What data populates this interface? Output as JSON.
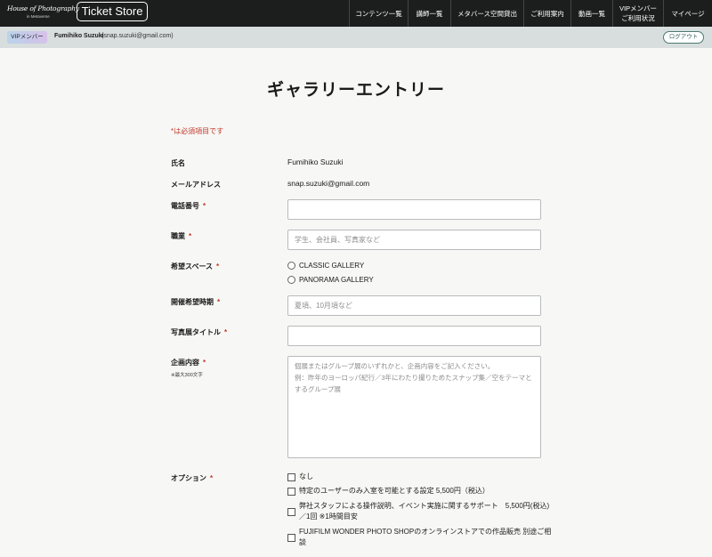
{
  "header": {
    "logo_main": "House of Photography",
    "logo_sub": "in Metaverse",
    "ticket_store": "Ticket Store",
    "nav": [
      {
        "label": "コンテンツ一覧"
      },
      {
        "label": "講師一覧"
      },
      {
        "label": "メタバース空間貸出"
      },
      {
        "label": "ご利用案内"
      },
      {
        "label": "動画一覧"
      },
      {
        "label": "VIPメンバー\nご利用状況"
      },
      {
        "label": "マイページ"
      }
    ]
  },
  "member_bar": {
    "badge": "VIPメンバー",
    "name": "Fumihiko Suzuki",
    "email": "(snap.suzuki@gmail.com)",
    "logout_label": "ログアウト"
  },
  "form": {
    "title": "ギャラリーエントリー",
    "required_note": "*は必須項目です",
    "required_mark": "*",
    "name_label": "氏名",
    "name_value": "Fumihiko Suzuki",
    "email_label": "メールアドレス",
    "email_value": "snap.suzuki@gmail.com",
    "phone_label": "電話番号",
    "phone_value": "",
    "job_label": "職業",
    "job_placeholder": "学生、会社員、写真家など",
    "space_label": "希望スペース",
    "space_options": [
      "CLASSIC GALLERY",
      "PANORAMA GALLERY"
    ],
    "period_label": "開催希望時期",
    "period_placeholder": "夏頃、10月頃など",
    "title_label": "写真展タイトル",
    "title_value": "",
    "plan_label": "企画内容",
    "plan_hint": "※最大300文字",
    "plan_placeholder": "個展またはグループ展のいずれかと、企画内容をご記入ください。\n例：昨年のヨーロッパ紀行／3年にわたり撮りためたスナップ集／空をテーマとするグループ展",
    "option_label": "オプション",
    "options": [
      "なし",
      "特定のユーザーのみ入室を可能とする設定 5,500円（税込）",
      "弊社スタッフによる操作説明、イベント実施に関するサポート　5,500円(税込)／1回 ※1時間目安",
      "FUJIFILM WONDER PHOTO SHOPのオンラインストアでの作品販売 別途ご相談"
    ]
  },
  "colors": {
    "header_bg": "#1c1e1e",
    "member_bar_bg": "#d8dedd",
    "page_bg": "#f7f7f5",
    "required_red": "#c0392b",
    "logout_border": "#4a7a72"
  }
}
